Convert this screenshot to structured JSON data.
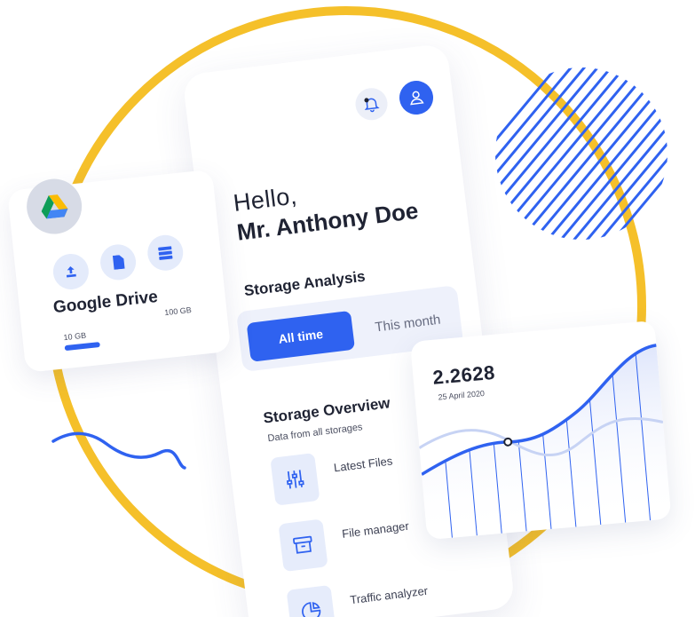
{
  "header": {
    "greeting": "Hello,",
    "name": "Mr. Anthony Doe"
  },
  "storage_analysis": {
    "title": "Storage Analysis",
    "options": [
      "All time",
      "This month"
    ],
    "selected": "All time"
  },
  "storage_overview": {
    "title": "Storage Overview",
    "subtitle": "Data from all storages",
    "items": [
      {
        "label": "Latest Files",
        "icon": "sliders-icon"
      },
      {
        "label": "File manager",
        "icon": "archive-box-icon"
      },
      {
        "label": "Traffic analyzer",
        "icon": "pie-chart-icon"
      }
    ]
  },
  "google_drive": {
    "title": "Google Drive",
    "capacity": "100 GB",
    "used": "10 GB",
    "used_fraction": 0.1,
    "actions": [
      "upload-icon",
      "file-icon",
      "storage-icon"
    ]
  },
  "stats": {
    "value": "2.2628",
    "date": "25 April 2020"
  },
  "colors": {
    "accent": "#2f62f0",
    "ring": "#f5c02a",
    "text": "#1f2333",
    "tile": "#e6ecfb"
  }
}
